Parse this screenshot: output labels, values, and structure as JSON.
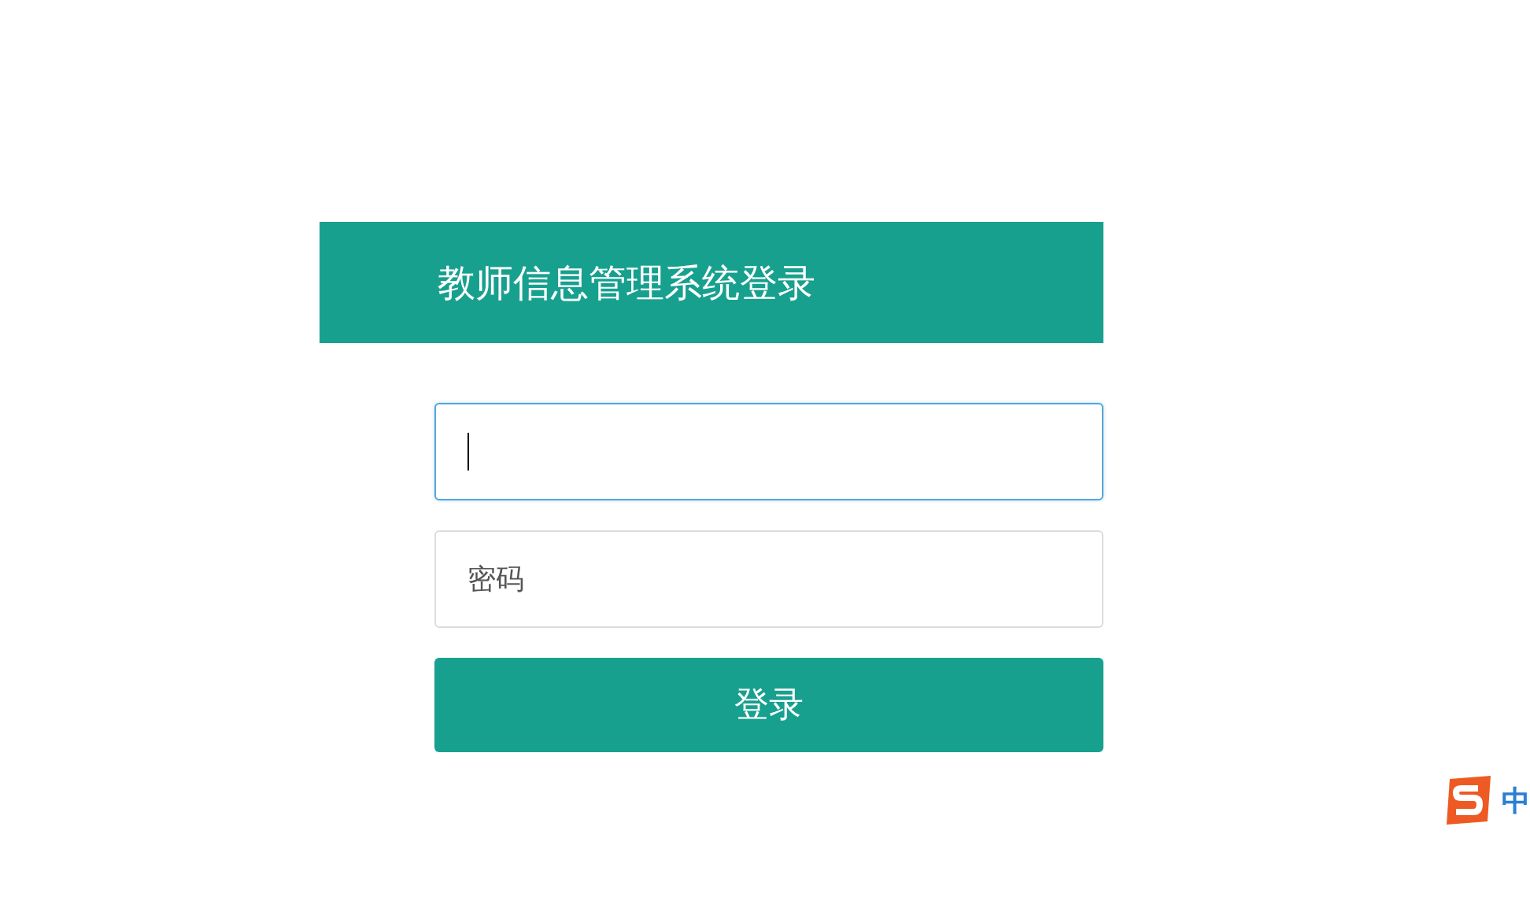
{
  "login": {
    "title": "教师信息管理系统登录",
    "fields": [
      {
        "focused": true
      },
      {
        "placeholder": "密码",
        "focused": false
      }
    ],
    "submit": "登录"
  },
  "ime_status": {
    "mode": "中"
  }
}
